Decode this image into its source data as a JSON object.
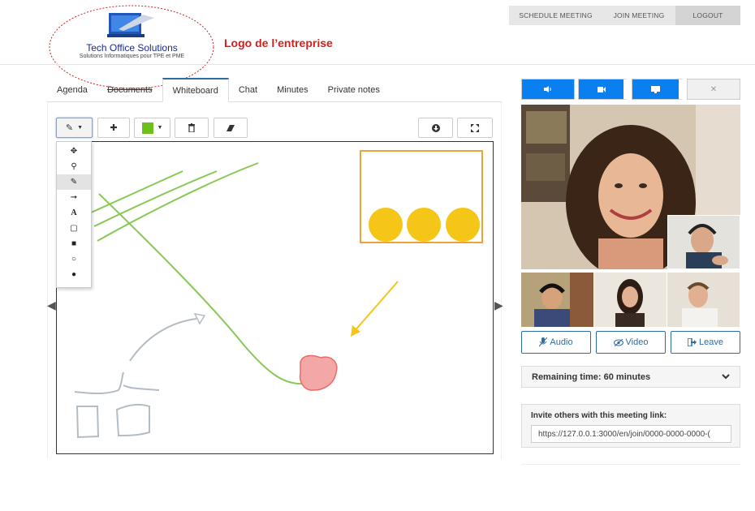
{
  "logo": {
    "name": "Tech Office Solutions",
    "tagline": "Solutions Informatiques pour TPE et PME",
    "caption": "Logo de l’entreprise",
    "ellipse_color": "#d0221c"
  },
  "topbar": {
    "schedule": "SCHEDULE MEETING",
    "join": "JOIN MEETING",
    "logout": "LOGOUT"
  },
  "tabs": [
    {
      "label": "Agenda"
    },
    {
      "label": "Documents"
    },
    {
      "label": "Whiteboard",
      "active": true
    },
    {
      "label": "Chat"
    },
    {
      "label": "Minutes"
    },
    {
      "label": "Private notes"
    }
  ],
  "toolbar": {
    "pen_icon": "pencil-icon",
    "add_icon": "plus-icon",
    "color": "#6cbf1c",
    "delete_icon": "trash-icon",
    "eraser_icon": "eraser-icon",
    "download_icon": "download-icon",
    "fullscreen_icon": "fullscreen-icon"
  },
  "tool_menu": [
    {
      "icon": "move-icon",
      "glyph": "✥"
    },
    {
      "icon": "bulb-icon",
      "glyph": "⚲"
    },
    {
      "icon": "pencil-icon",
      "glyph": "✎",
      "selected": true
    },
    {
      "icon": "arrow-icon",
      "glyph": "➞"
    },
    {
      "icon": "text-icon",
      "glyph": "A"
    },
    {
      "icon": "rect-outline-icon",
      "glyph": "▢"
    },
    {
      "icon": "rect-filled-icon",
      "glyph": "■"
    },
    {
      "icon": "circle-outline-icon",
      "glyph": "○"
    },
    {
      "icon": "circle-filled-icon",
      "glyph": "●"
    }
  ],
  "media": {
    "accent": "#0a7ff0",
    "audio_icon": "speaker-icon",
    "video_icon": "camera-icon",
    "screen_icon": "monitor-icon",
    "close_icon": "close-icon",
    "close_glyph": "✕"
  },
  "actions": {
    "audio": "Audio",
    "video": "Video",
    "leave": "Leave"
  },
  "remaining": {
    "label": "Remaining time: 60 minutes"
  },
  "invite": {
    "label": "Invite others with this meeting link:",
    "link": "https://127.0.0.1:3000/en/join/0000-0000-0000-("
  }
}
